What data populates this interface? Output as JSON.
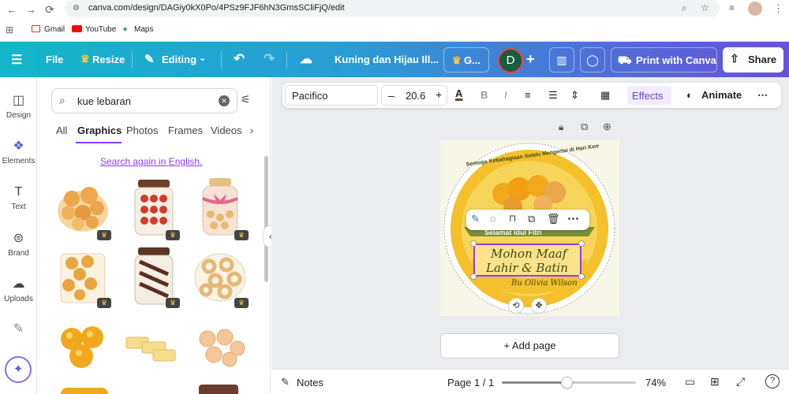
{
  "browser": {
    "url": "canva.com/design/DAGiy0kX0Po/4PSz9FJF6hN3GmsSCliFjQ/edit",
    "bookmarks": [
      "Gmail",
      "YouTube",
      "Maps"
    ]
  },
  "header": {
    "file": "File",
    "resize": "Resize",
    "editing": "Editing",
    "title": "Kuning dan Hijau Ill...",
    "team_badge": "G...",
    "avatar_letter": "D",
    "print": "Print with Canva",
    "share": "Share"
  },
  "rail": [
    "Design",
    "Elements",
    "Text",
    "Brand",
    "Uploads"
  ],
  "panel": {
    "search_value": "kue lebaran",
    "tabs": [
      "All",
      "Graphics",
      "Photos",
      "Frames",
      "Videos"
    ],
    "active_tab": "Graphics",
    "search_again": "Search again in English."
  },
  "toolbar": {
    "font": "Pacifico",
    "font_size": "20.6",
    "effects": "Effects",
    "animate": "Animate"
  },
  "design": {
    "arc_text": "Semoga Kebahagiaan Selalu Mengertai di Hari Kemenangan Ini",
    "banner": "Selamat Idul Fitri",
    "line1": "Mohon Maaf",
    "line2": "Lahir & Batin",
    "signature": "Bu Olivia Wilson"
  },
  "add_page": "+ Add page",
  "bottom": {
    "notes": "Notes",
    "page": "Page 1 / 1",
    "zoom": "74%",
    "zoom_fraction": 0.74
  },
  "colors": {
    "accent": "#8b3dff",
    "header_start": "#12b6c8",
    "header_end": "#6a4fd8",
    "design_bg": "#f7f6e8",
    "design_yellow": "#f4c02b",
    "design_green": "#7a8f3a"
  }
}
